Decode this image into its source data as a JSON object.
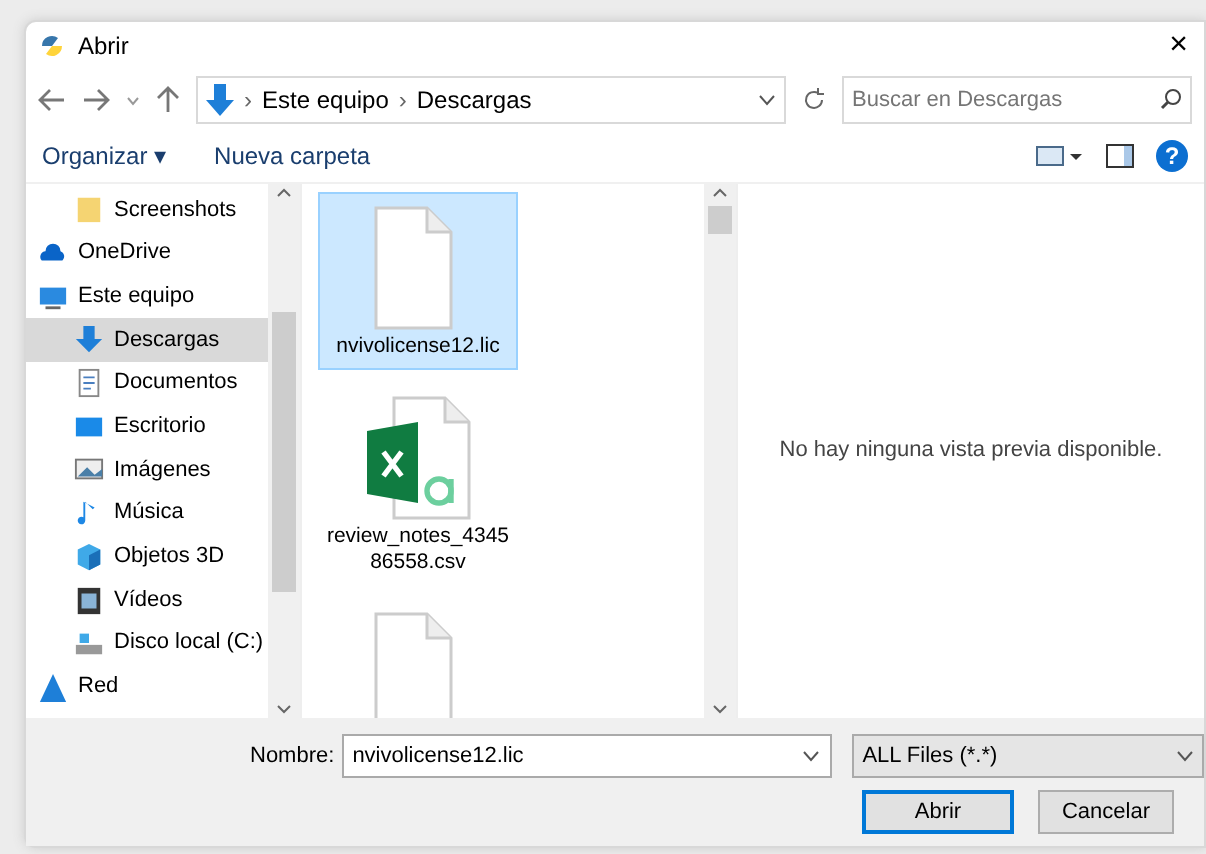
{
  "window": {
    "title": "Abrir",
    "close": "×"
  },
  "address": {
    "path": [
      {
        "label": "Este equipo"
      },
      {
        "label": "Descargas"
      }
    ],
    "separator": "›"
  },
  "search": {
    "placeholder": "Buscar en Descargas"
  },
  "toolbar": {
    "organize": "Organizar ▾",
    "new_folder": "Nueva carpeta",
    "help": "?"
  },
  "sidebar": {
    "items": [
      {
        "label": "Screenshots",
        "kind": "folder",
        "selected": false,
        "indent": true
      },
      {
        "label": "OneDrive",
        "kind": "cloud",
        "selected": false,
        "indent": false
      },
      {
        "label": "Este equipo",
        "kind": "pc",
        "selected": false,
        "indent": false
      },
      {
        "label": "Descargas",
        "kind": "download",
        "selected": true,
        "indent": true
      },
      {
        "label": "Documentos",
        "kind": "doc",
        "selected": false,
        "indent": true
      },
      {
        "label": "Escritorio",
        "kind": "desktop",
        "selected": false,
        "indent": true
      },
      {
        "label": "Imágenes",
        "kind": "image",
        "selected": false,
        "indent": true
      },
      {
        "label": "Música",
        "kind": "music",
        "selected": false,
        "indent": true
      },
      {
        "label": "Objetos 3D",
        "kind": "cube",
        "selected": false,
        "indent": true
      },
      {
        "label": "Vídeos",
        "kind": "video",
        "selected": false,
        "indent": true
      },
      {
        "label": "Disco local (C:)",
        "kind": "drive",
        "selected": false,
        "indent": true
      },
      {
        "label": "Red",
        "kind": "network",
        "selected": false,
        "indent": false
      }
    ]
  },
  "files": [
    {
      "name": "nvivolicense12.lic",
      "kind": "blank",
      "selected": true
    },
    {
      "name": "review_notes_434586558.csv",
      "kind": "excel",
      "selected": false
    },
    {
      "kind": "blank",
      "selected": false
    }
  ],
  "preview": {
    "message": "No hay ninguna vista previa disponible."
  },
  "footer": {
    "name_label": "Nombre:",
    "name_value": "nvivolicense12.lic",
    "filter": "ALL Files (*.*)",
    "open": "Abrir",
    "cancel": "Cancelar"
  }
}
